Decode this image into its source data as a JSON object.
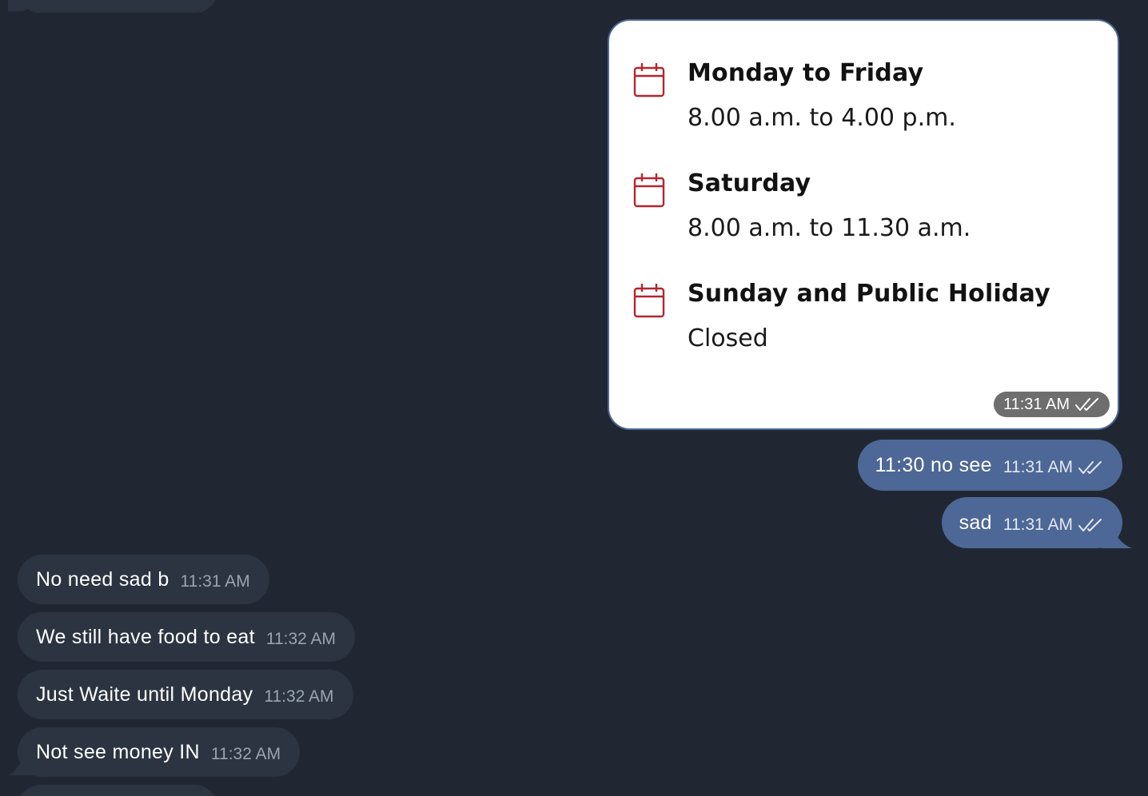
{
  "schedule": [
    {
      "day": "Monday to Friday",
      "hours": "8.00 a.m. to 4.00 p.m."
    },
    {
      "day": "Saturday",
      "hours": "8.00 a.m. to 11.30 a.m."
    },
    {
      "day": "Sunday and Public Holiday",
      "hours": "Closed"
    }
  ],
  "image_message": {
    "time": "11:31 AM",
    "icon": "double-check-icon"
  },
  "outgoing": [
    {
      "text": "11:30 no see",
      "time": "11:31 AM",
      "icon": "double-check-icon"
    },
    {
      "text": "sad",
      "time": "11:31 AM",
      "icon": "double-check-icon"
    }
  ],
  "incoming": [
    {
      "text": "No need sad b",
      "time": "11:31 AM"
    },
    {
      "text": "We still have food to eat",
      "time": "11:32 AM"
    },
    {
      "text": "Just Waite until Monday",
      "time": "11:32 AM"
    },
    {
      "text": "Not see money IN",
      "time": "11:32 AM"
    }
  ],
  "colors": {
    "background": "#212732",
    "outgoing_bubble": "#4d6896",
    "incoming_bubble": "#2c3441",
    "calendar_icon": "#b3262d"
  }
}
